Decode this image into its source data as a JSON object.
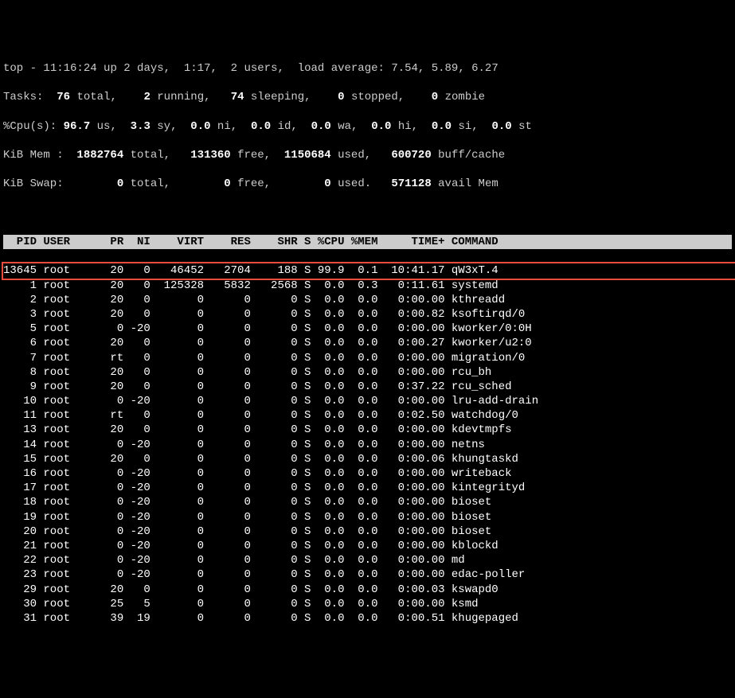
{
  "summary": {
    "line1_prefix": "top - ",
    "time": "11:16:24",
    "uptime": " up 2 days,  1:17,  ",
    "users": "2 users",
    "loadavg_label": ",  load average: ",
    "loadavg": "7.54, 5.89, 6.27",
    "tasks_label": "Tasks:",
    "tasks_total": "  76 ",
    "tasks_total_label": "total,",
    "tasks_running": "    2 ",
    "tasks_running_label": "running,",
    "tasks_sleeping": "   74 ",
    "tasks_sleeping_label": "sleeping,",
    "tasks_stopped": "    0 ",
    "tasks_stopped_label": "stopped,",
    "tasks_zombie": "    0 ",
    "tasks_zombie_label": "zombie",
    "cpu_label": "%Cpu(s):",
    "cpu_us": " 96.7 ",
    "cpu_us_label": "us,",
    "cpu_sy": "  3.3 ",
    "cpu_sy_label": "sy,",
    "cpu_ni": "  0.0 ",
    "cpu_ni_label": "ni,",
    "cpu_id": "  0.0 ",
    "cpu_id_label": "id,",
    "cpu_wa": "  0.0 ",
    "cpu_wa_label": "wa,",
    "cpu_hi": "  0.0 ",
    "cpu_hi_label": "hi,",
    "cpu_si": "  0.0 ",
    "cpu_si_label": "si,",
    "cpu_st": "  0.0 ",
    "cpu_st_label": "st",
    "mem_label": "KiB Mem :",
    "mem_total": "  1882764 ",
    "mem_total_label": "total,",
    "mem_free": "   131360 ",
    "mem_free_label": "free,",
    "mem_used": "  1150684 ",
    "mem_used_label": "used,",
    "mem_buff": "   600720 ",
    "mem_buff_label": "buff/cache",
    "swap_label": "KiB Swap:",
    "swap_total": "        0 ",
    "swap_total_label": "total,",
    "swap_free": "        0 ",
    "swap_free_label": "free,",
    "swap_used": "        0 ",
    "swap_used_label": "used.",
    "swap_avail": "   571128 ",
    "swap_avail_label": "avail Mem"
  },
  "columns": "  PID USER      PR  NI    VIRT    RES    SHR S %CPU %MEM     TIME+ COMMAND                                    ",
  "processes": [
    {
      "highlighted": true,
      "text": "13645 root      20   0   46452   2704    188 S 99.9  0.1  10:41.17 qW3xT.4                                    "
    },
    {
      "highlighted": false,
      "text": "    1 root      20   0  125328   5832   2568 S  0.0  0.3   0:11.61 systemd"
    },
    {
      "highlighted": false,
      "text": "    2 root      20   0       0      0      0 S  0.0  0.0   0:00.00 kthreadd"
    },
    {
      "highlighted": false,
      "text": "    3 root      20   0       0      0      0 S  0.0  0.0   0:00.82 ksoftirqd/0"
    },
    {
      "highlighted": false,
      "text": "    5 root       0 -20       0      0      0 S  0.0  0.0   0:00.00 kworker/0:0H"
    },
    {
      "highlighted": false,
      "text": "    6 root      20   0       0      0      0 S  0.0  0.0   0:00.27 kworker/u2:0"
    },
    {
      "highlighted": false,
      "text": "    7 root      rt   0       0      0      0 S  0.0  0.0   0:00.00 migration/0"
    },
    {
      "highlighted": false,
      "text": "    8 root      20   0       0      0      0 S  0.0  0.0   0:00.00 rcu_bh"
    },
    {
      "highlighted": false,
      "text": "    9 root      20   0       0      0      0 S  0.0  0.0   0:37.22 rcu_sched"
    },
    {
      "highlighted": false,
      "text": "   10 root       0 -20       0      0      0 S  0.0  0.0   0:00.00 lru-add-drain"
    },
    {
      "highlighted": false,
      "text": "   11 root      rt   0       0      0      0 S  0.0  0.0   0:02.50 watchdog/0"
    },
    {
      "highlighted": false,
      "text": "   13 root      20   0       0      0      0 S  0.0  0.0   0:00.00 kdevtmpfs"
    },
    {
      "highlighted": false,
      "text": "   14 root       0 -20       0      0      0 S  0.0  0.0   0:00.00 netns"
    },
    {
      "highlighted": false,
      "text": "   15 root      20   0       0      0      0 S  0.0  0.0   0:00.06 khungtaskd"
    },
    {
      "highlighted": false,
      "text": "   16 root       0 -20       0      0      0 S  0.0  0.0   0:00.00 writeback"
    },
    {
      "highlighted": false,
      "text": "   17 root       0 -20       0      0      0 S  0.0  0.0   0:00.00 kintegrityd"
    },
    {
      "highlighted": false,
      "text": "   18 root       0 -20       0      0      0 S  0.0  0.0   0:00.00 bioset"
    },
    {
      "highlighted": false,
      "text": "   19 root       0 -20       0      0      0 S  0.0  0.0   0:00.00 bioset"
    },
    {
      "highlighted": false,
      "text": "   20 root       0 -20       0      0      0 S  0.0  0.0   0:00.00 bioset"
    },
    {
      "highlighted": false,
      "text": "   21 root       0 -20       0      0      0 S  0.0  0.0   0:00.00 kblockd"
    },
    {
      "highlighted": false,
      "text": "   22 root       0 -20       0      0      0 S  0.0  0.0   0:00.00 md"
    },
    {
      "highlighted": false,
      "text": "   23 root       0 -20       0      0      0 S  0.0  0.0   0:00.00 edac-poller"
    },
    {
      "highlighted": false,
      "text": "   29 root      20   0       0      0      0 S  0.0  0.0   0:00.03 kswapd0"
    },
    {
      "highlighted": false,
      "text": "   30 root      25   5       0      0      0 S  0.0  0.0   0:00.00 ksmd"
    },
    {
      "highlighted": false,
      "text": "   31 root      39  19       0      0      0 S  0.0  0.0   0:00.51 khugepaged"
    }
  ]
}
